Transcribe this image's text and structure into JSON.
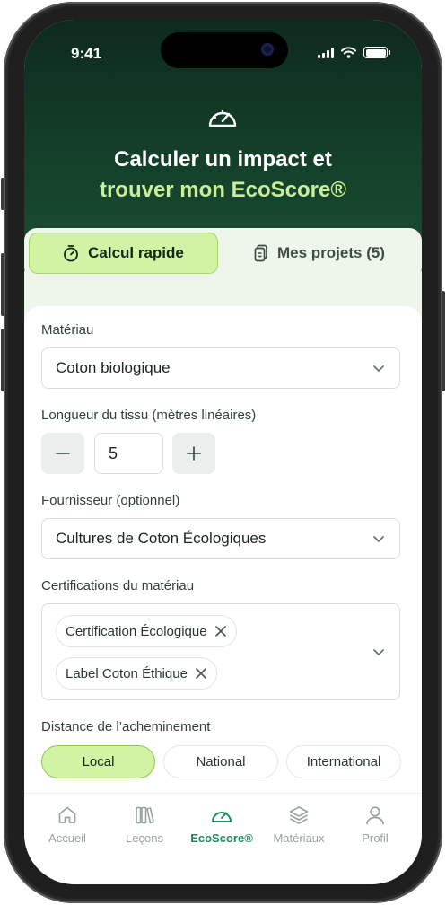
{
  "status_bar": {
    "time": "9:41"
  },
  "hero": {
    "title_line1": "Calculer un impact et",
    "title_line2": "trouver mon EcoScore®",
    "icon": "gauge-icon"
  },
  "tabs": [
    {
      "label": "Calcul rapide",
      "icon": "stopwatch-icon",
      "active": true
    },
    {
      "label": "Mes projets (5)",
      "icon": "documents-icon",
      "active": false
    }
  ],
  "form": {
    "material": {
      "label": "Matériau",
      "value": "Coton biologique"
    },
    "length": {
      "label": "Longueur du tissu (mètres linéaires)",
      "value": "5"
    },
    "supplier": {
      "label": "Fournisseur (optionnel)",
      "value": "Cultures de Coton Écologiques"
    },
    "certifications": {
      "label": "Certifications du matériau",
      "items": [
        "Certification Écologique",
        "Label Coton Éthique"
      ]
    },
    "distance": {
      "label": "Distance de l’acheminement",
      "options": [
        "Local",
        "National",
        "International"
      ],
      "selected": "Local"
    }
  },
  "bottom_nav": [
    {
      "label": "Accueil",
      "icon": "home-icon",
      "active": false
    },
    {
      "label": "Leçons",
      "icon": "books-icon",
      "active": false
    },
    {
      "label": "EcoScore®",
      "icon": "gauge-icon",
      "active": true
    },
    {
      "label": "Matériaux",
      "icon": "layers-icon",
      "active": false
    },
    {
      "label": "Profil",
      "icon": "user-icon",
      "active": false
    }
  ],
  "colors": {
    "hero_dark": "#0e2a1e",
    "accent_green": "#c9ef9a",
    "active_chip": "#d2f3a4",
    "nav_active": "#1d8a5b"
  }
}
